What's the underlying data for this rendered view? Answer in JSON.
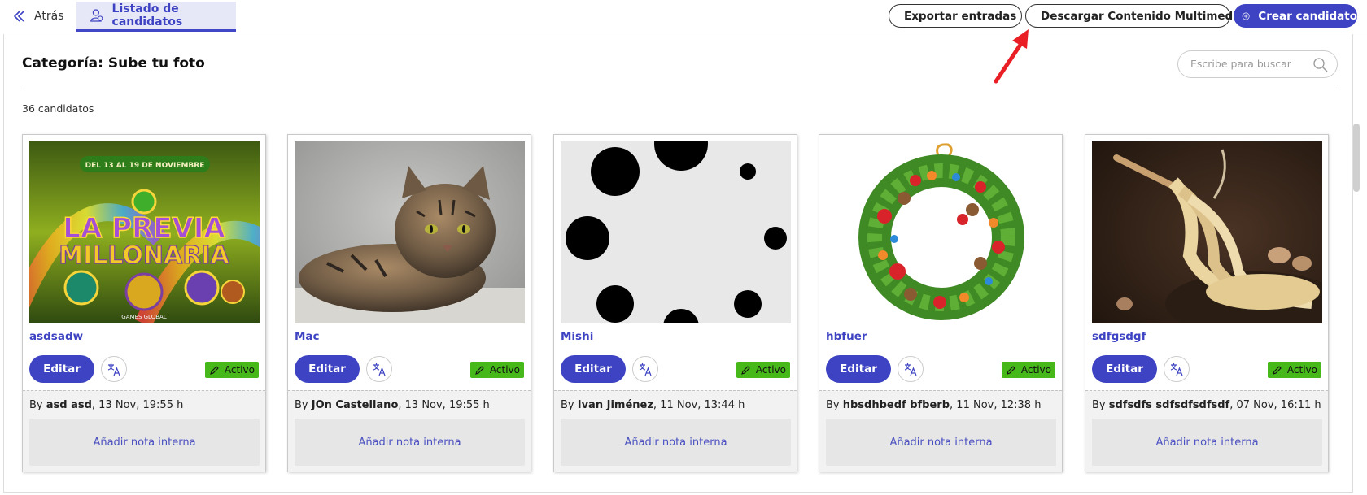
{
  "header": {
    "back_label": "Atrás",
    "tab_label": "Listado de candidatos",
    "export_label": "Exportar entradas",
    "download_label": "Descargar Contenido Multimedia",
    "create_label": "Crear candidato",
    "accent_color": "#3d43c2"
  },
  "page": {
    "title": "Categoría: Sube tu foto",
    "search_placeholder": "Escribe para buscar",
    "count_text": "36 candidatos"
  },
  "cards": [
    {
      "name": "asdsadw",
      "edit_label": "Editar",
      "status": "Activo",
      "by_prefix": "By ",
      "author": "asd asd",
      "date": ", 13 Nov, 19:55 h",
      "note_label": "Añadir nota interna"
    },
    {
      "name": "Mac",
      "edit_label": "Editar",
      "status": "Activo",
      "by_prefix": "By ",
      "author": "JOn Castellano",
      "date": ", 13 Nov, 19:55 h",
      "note_label": "Añadir nota interna"
    },
    {
      "name": "Mishi",
      "edit_label": "Editar",
      "status": "Activo",
      "by_prefix": "By ",
      "author": "Ivan Jiménez",
      "date": ", 11 Nov, 13:44 h",
      "note_label": "Añadir nota interna"
    },
    {
      "name": "hbfuer",
      "edit_label": "Editar",
      "status": "Activo",
      "by_prefix": "By ",
      "author": "hbsdhbedf bfberb",
      "date": ", 11 Nov, 12:38 h",
      "note_label": "Añadir nota interna"
    },
    {
      "name": "sdfgsdgf",
      "edit_label": "Editar",
      "status": "Activo",
      "by_prefix": "By ",
      "author": "sdfsdfs sdfsdfsdfsdf",
      "date": ", 07 Nov, 16:11 h",
      "note_label": "Añadir nota interna"
    }
  ],
  "thumbnail_text": {
    "promo_dates": "DEL 13 AL 19 DE NOVIEMBRE",
    "promo_title_1": "LA PREVIA",
    "promo_title_2": "MILLONARIA",
    "promo_brand": "GAMES GLOBAL"
  }
}
